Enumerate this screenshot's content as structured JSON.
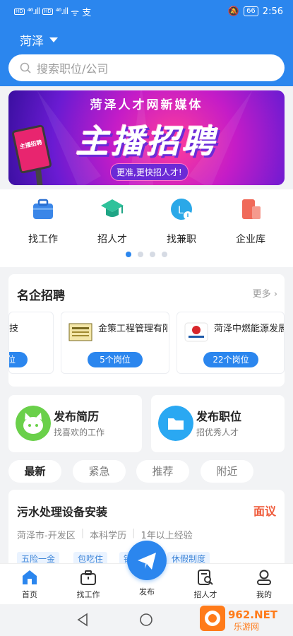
{
  "status": {
    "hd1": "HD",
    "hd2": "HD",
    "sig1": "⁴⁶.ıll",
    "sig2": "⁴⁶.ıll",
    "extra": "ᯤ 支",
    "battery": "66",
    "time": "2:56"
  },
  "header": {
    "city": "菏泽",
    "search_placeholder": "搜索职位/公司"
  },
  "banner": {
    "line1": "菏泽人才网新媒体",
    "line2": "主播招聘",
    "slogan": "更准,更快招人才!",
    "phone_text": "主播招聘"
  },
  "quick_icons": [
    {
      "label": "找工作",
      "icon": "briefcase-icon",
      "color": "#3a86e8"
    },
    {
      "label": "招人才",
      "icon": "grad-cap-icon",
      "color": "#2ec29b"
    },
    {
      "label": "找兼职",
      "icon": "parttime-icon",
      "color": "#2aa8e8"
    },
    {
      "label": "企业库",
      "icon": "building-icon",
      "color": "#f06a5a"
    }
  ],
  "carousel": {
    "count": 4,
    "active": 0
  },
  "famous": {
    "title": "名企招聘",
    "more": "更多",
    "companies": [
      {
        "name": "技",
        "button": "位"
      },
      {
        "name": "金策工程管理有限",
        "button": "5个岗位"
      },
      {
        "name": "菏泽中燃能源发展",
        "button": "22个岗位"
      }
    ]
  },
  "publish": [
    {
      "title": "发布简历",
      "subtitle": "找喜欢的工作",
      "icon": "resume-icon"
    },
    {
      "title": "发布职位",
      "subtitle": "招优秀人才",
      "icon": "folder-icon"
    }
  ],
  "tabs": [
    {
      "label": "最新",
      "active": true
    },
    {
      "label": "紧急",
      "active": false
    },
    {
      "label": "推荐",
      "active": false
    },
    {
      "label": "附近",
      "active": false
    }
  ],
  "job": {
    "title": "污水处理设备安装",
    "salary": "面议",
    "location": "菏泽市-开发区",
    "education": "本科学历",
    "experience": "1年以上经验",
    "tags": [
      "五险一金",
      "包吃住",
      "销",
      "休假制度"
    ]
  },
  "tabbar": [
    {
      "label": "首页",
      "icon": "home-icon",
      "active": true
    },
    {
      "label": "找工作",
      "icon": "briefcase-icon"
    },
    {
      "label": "发布",
      "icon": "send-icon"
    },
    {
      "label": "招人才",
      "icon": "search-doc-icon"
    },
    {
      "label": "我的",
      "icon": "profile-icon"
    }
  ],
  "watermark": {
    "text": "962.NET",
    "sub": "乐游网"
  },
  "colors": {
    "primary": "#2b86ee",
    "salary": "#ef5a3a"
  }
}
